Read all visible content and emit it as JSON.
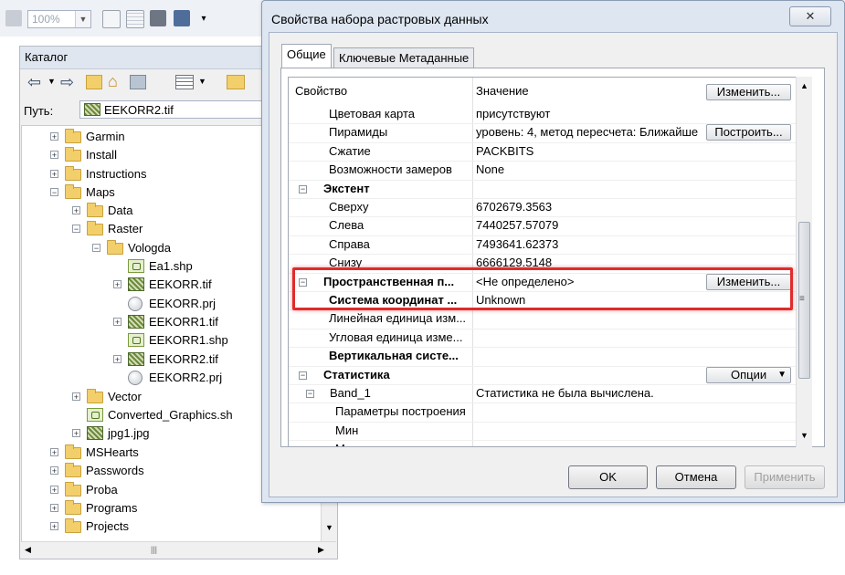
{
  "toolbar": {
    "zoom_value": "100%"
  },
  "catalog": {
    "title": "Каталог",
    "path_label": "Путь:",
    "path_value": "EEKORR2.tif",
    "tree": [
      {
        "label": "Garmin",
        "icon": "folder-icon",
        "expand": "+"
      },
      {
        "label": "Install",
        "icon": "folder-icon",
        "expand": "+"
      },
      {
        "label": "Instructions",
        "icon": "folder-icon",
        "expand": "+"
      },
      {
        "label": "Maps",
        "icon": "folder-icon",
        "expand": "−"
      },
      {
        "label": "Data",
        "icon": "folder-icon",
        "expand": "+"
      },
      {
        "label": "Raster",
        "icon": "folder-icon",
        "expand": "−"
      },
      {
        "label": "Vologda",
        "icon": "folder-icon",
        "expand": "−"
      },
      {
        "label": "Ea1.shp",
        "icon": "shapefile-icon",
        "expand": ""
      },
      {
        "label": "EEKORR.tif",
        "icon": "raster-icon",
        "expand": "+"
      },
      {
        "label": "EEKORR.prj",
        "icon": "projection-file-icon",
        "expand": ""
      },
      {
        "label": "EEKORR1.tif",
        "icon": "raster-icon",
        "expand": "+"
      },
      {
        "label": "EEKORR1.shp",
        "icon": "shapefile-icon",
        "expand": ""
      },
      {
        "label": "EEKORR2.tif",
        "icon": "raster-icon",
        "expand": "+"
      },
      {
        "label": "EEKORR2.prj",
        "icon": "projection-file-icon",
        "expand": ""
      },
      {
        "label": "Vector",
        "icon": "folder-icon",
        "expand": "+"
      },
      {
        "label": "Converted_Graphics.sh",
        "icon": "shapefile-icon",
        "expand": ""
      },
      {
        "label": "jpg1.jpg",
        "icon": "raster-icon",
        "expand": "+"
      },
      {
        "label": "MSHearts",
        "icon": "folder-icon",
        "expand": "+"
      },
      {
        "label": "Passwords",
        "icon": "folder-icon",
        "expand": "+"
      },
      {
        "label": "Proba",
        "icon": "folder-icon",
        "expand": "+"
      },
      {
        "label": "Programs",
        "icon": "folder-icon",
        "expand": "+"
      },
      {
        "label": "Projects",
        "icon": "folder-icon",
        "expand": "+"
      }
    ]
  },
  "dialog": {
    "title": "Свойства набора растровых данных",
    "close_glyph": "✕",
    "tabs": [
      "Общие",
      "Ключевые Метаданные"
    ],
    "header": {
      "col1": "Свойство",
      "col2": "Значение",
      "button": "Изменить..."
    },
    "rows": [
      {
        "prop": "Цветовая карта",
        "value": "присутствуют"
      },
      {
        "prop": "Пирамиды",
        "value": "уровень: 4, метод пересчета: Ближайше",
        "button": "Построить..."
      },
      {
        "prop": "Сжатие",
        "value": "PACKBITS"
      },
      {
        "prop": "Возможности замеров",
        "value": "None"
      },
      {
        "prop": "Экстент",
        "section": true
      },
      {
        "prop": "Сверху",
        "value": "6702679.3563"
      },
      {
        "prop": "Слева",
        "value": "7440257.57079"
      },
      {
        "prop": "Справа",
        "value": "7493641.62373"
      },
      {
        "prop": "Снизу",
        "value": "6666129.5148"
      },
      {
        "prop": "Пространственная п...",
        "value": "<Не определено>",
        "section": true,
        "button": "Изменить..."
      },
      {
        "prop": "Система координат ...",
        "value": "Unknown",
        "bold": true
      },
      {
        "prop": "Линейная единица изм...",
        "value": ""
      },
      {
        "prop": "Угловая единица изме...",
        "value": ""
      },
      {
        "prop": "Вертикальная систе...",
        "value": "",
        "bold": true
      },
      {
        "prop": "Статистика",
        "section": true,
        "button": "Опции"
      },
      {
        "prop": "Band_1",
        "value": "Статистика не была вычислена.",
        "sub": true
      },
      {
        "prop": "Параметры построения",
        "value": ""
      },
      {
        "prop": "Мин",
        "value": ""
      },
      {
        "prop": "М...",
        "value": ""
      }
    ],
    "buttons": {
      "ok": "OK",
      "cancel": "Отмена",
      "apply": "Применить"
    }
  },
  "colors": {
    "highlight": "#e02b2b",
    "dialog_frame": "#dde6f1"
  }
}
